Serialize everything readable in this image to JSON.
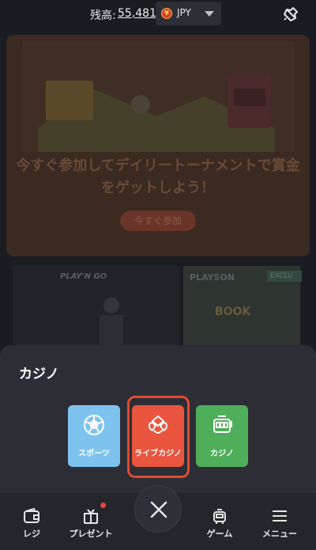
{
  "topbar": {
    "balance_label": "残高:",
    "balance_value": "55,481",
    "currency_code": "JPY",
    "currency_symbol": "¥"
  },
  "banner": {
    "title": "今すぐ参加してデイリートーナメントで賞金をゲットしよう！",
    "cta_label": "今すぐ参加"
  },
  "games": [
    {
      "provider": "PLAY'N GO"
    },
    {
      "provider": "PLAYSON",
      "badge": "EXCLU",
      "name": "BOOK"
    }
  ],
  "sheet": {
    "title": "カジノ",
    "categories": [
      {
        "label": "スポーツ",
        "icon": "soccer-ball-icon",
        "color": "#7ec3f0"
      },
      {
        "label": "ライブカジノ",
        "icon": "live-casino-icon",
        "color": "#e9553e",
        "highlighted": true
      },
      {
        "label": "カジノ",
        "icon": "slot-machine-icon",
        "color": "#4fae5a"
      }
    ]
  },
  "bottom_nav": {
    "items": [
      {
        "label": "レジ",
        "icon": "wallet-icon"
      },
      {
        "label": "プレゼント",
        "icon": "gift-icon",
        "has_notification": true
      },
      {
        "label": "ゲーム",
        "icon": "game-controller-icon"
      },
      {
        "label": "メニュー",
        "icon": "hamburger-menu-icon"
      }
    ],
    "close_icon": "close-icon"
  },
  "colors": {
    "accent": "#e9553e",
    "sports": "#7ec3f0",
    "casino": "#4fae5a",
    "notification": "#e8463e"
  }
}
